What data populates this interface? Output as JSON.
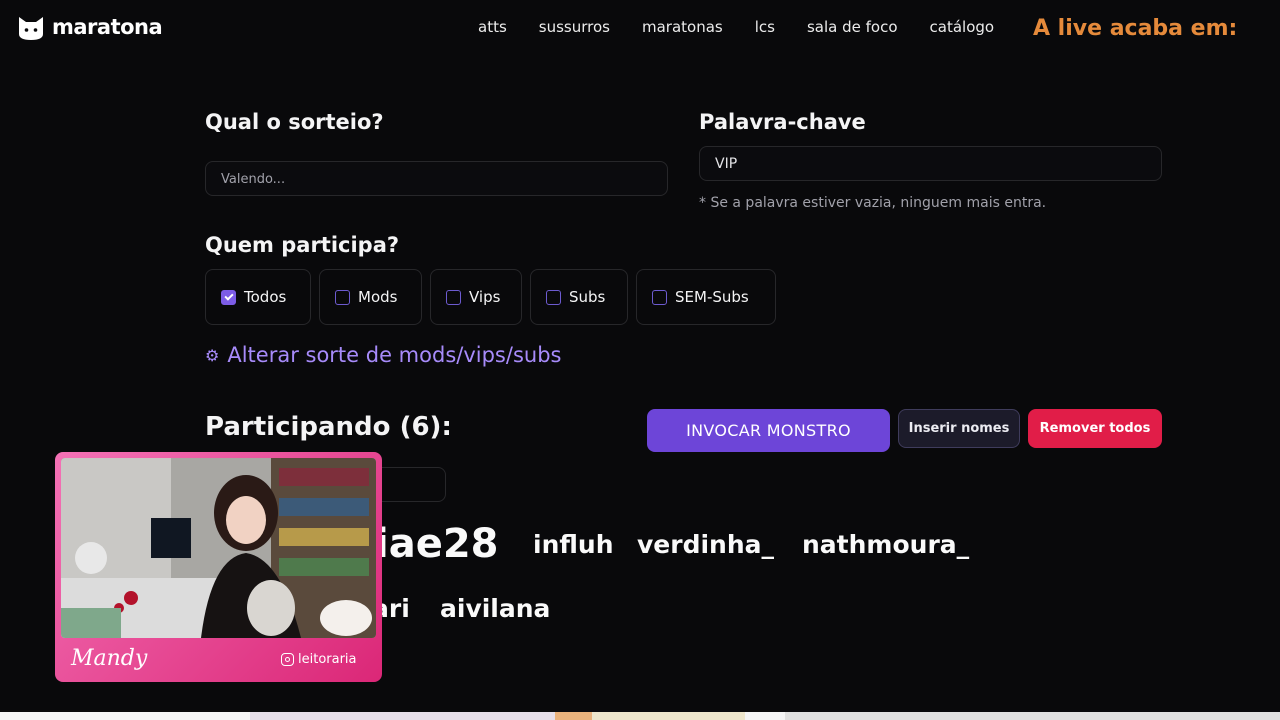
{
  "brand": {
    "name": "maratona",
    "logo_icon": "cat-logo-icon"
  },
  "nav": {
    "links": [
      "atts",
      "sussurros",
      "maratonas",
      "lcs",
      "sala de foco",
      "catálogo"
    ]
  },
  "live": {
    "countdown_label": "A live acaba em:"
  },
  "colors": {
    "accent": "#6d45d8",
    "link": "#a78bfa",
    "danger": "#e11d48",
    "timer": "#e58a3b"
  },
  "form": {
    "raffle_label": "Qual o sorteio?",
    "raffle_placeholder": "Valendo...",
    "keyword_label": "Palavra-chave",
    "keyword_value": "VIP",
    "keyword_hint": "* Se a palavra estiver vazia, ninguem mais entra.",
    "who_label": "Quem participa?",
    "options": [
      {
        "label": "Todos",
        "checked": true
      },
      {
        "label": "Mods",
        "checked": false
      },
      {
        "label": "Vips",
        "checked": false
      },
      {
        "label": "Subs",
        "checked": false
      },
      {
        "label": "SEM-Subs",
        "checked": false
      }
    ],
    "luck_link": "Alterar sorte de mods/vips/subs",
    "luck_icon": "gear-icon"
  },
  "participants": {
    "heading": "Participando (6):",
    "summon_label": "INVOCAR MONSTRO",
    "insert_label": "Inserir nomes",
    "remove_label": "Remover todos",
    "names": [
      "iae28",
      "influh",
      "verdinha_",
      "nathmoura_",
      "ari",
      "aivilana"
    ]
  },
  "webcam": {
    "streamer_name": "Mandy",
    "handle": "leitoraria",
    "handle_icon": "instagram-icon"
  }
}
